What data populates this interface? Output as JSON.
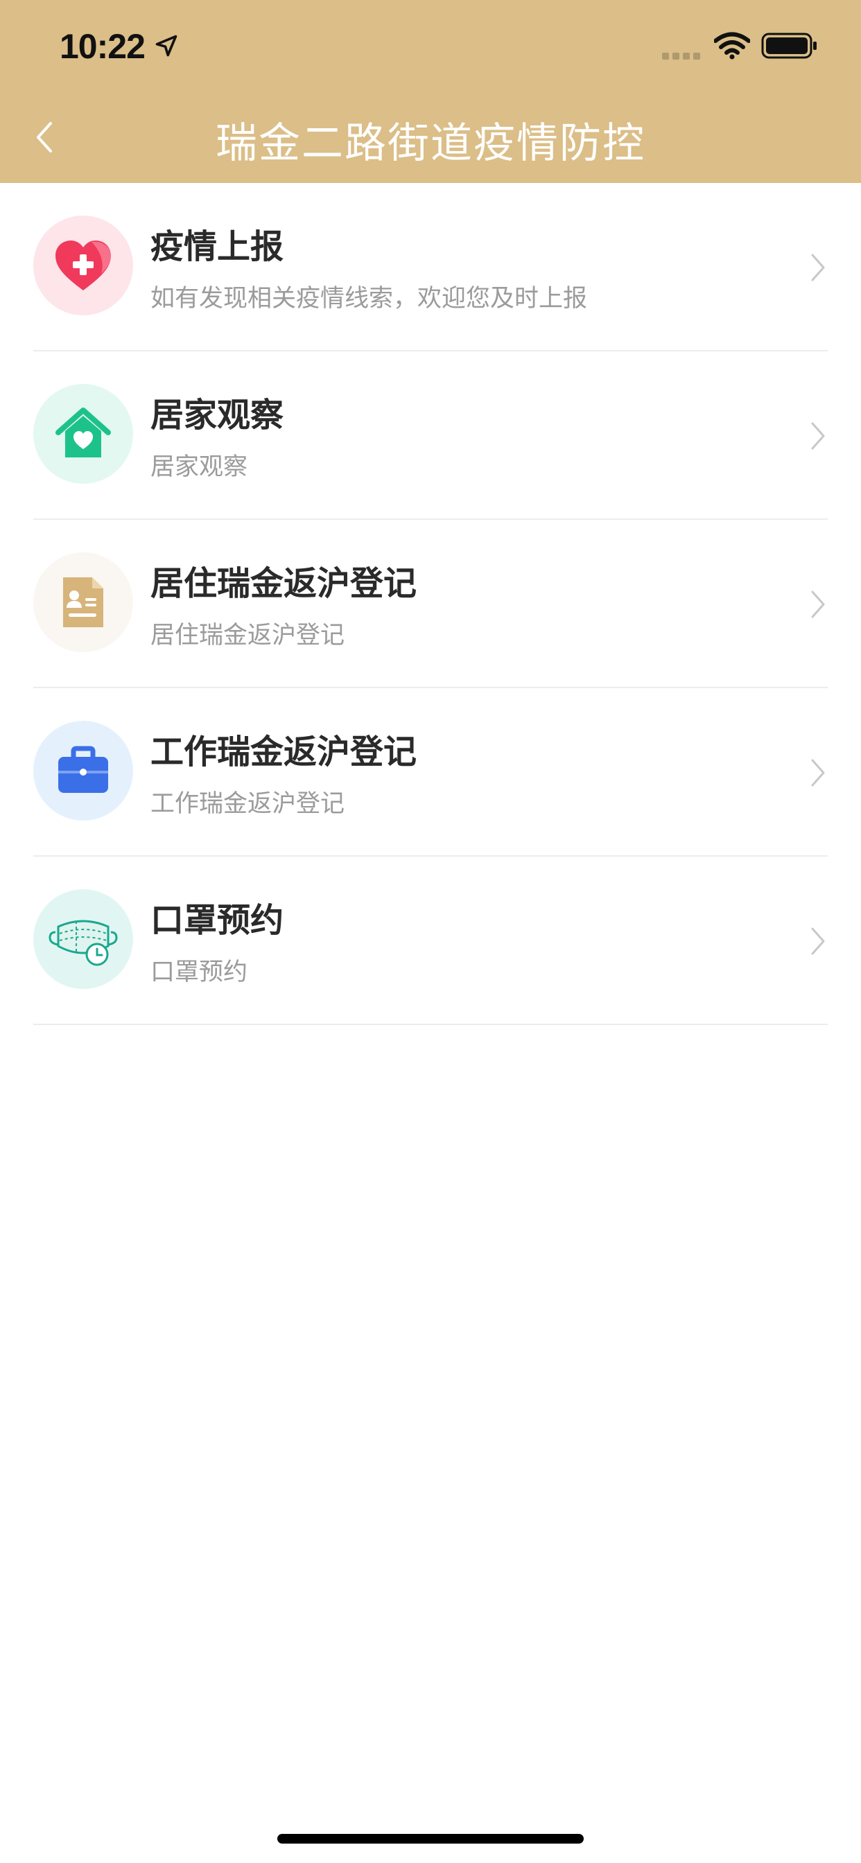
{
  "status_bar": {
    "time": "10:22"
  },
  "nav": {
    "title": "瑞金二路街道疫情防控"
  },
  "colors": {
    "header_bg": "#dbbe88",
    "title_text": "#2a2a2a",
    "subtitle_text": "#9b9b9b",
    "divider": "#ececec"
  },
  "items": [
    {
      "title": "疫情上报",
      "subtitle": "如有发现相关疫情线索，欢迎您及时上报",
      "icon": "heart-plus-icon",
      "icon_bg": "#fde5ea"
    },
    {
      "title": "居家观察",
      "subtitle": "居家观察",
      "icon": "home-heart-icon",
      "icon_bg": "#e3f8f0"
    },
    {
      "title": "居住瑞金返沪登记",
      "subtitle": "居住瑞金返沪登记",
      "icon": "id-document-icon",
      "icon_bg": "#faf6f1"
    },
    {
      "title": "工作瑞金返沪登记",
      "subtitle": "工作瑞金返沪登记",
      "icon": "briefcase-icon",
      "icon_bg": "#e4f1fd"
    },
    {
      "title": "口罩预约",
      "subtitle": "口罩预约",
      "icon": "mask-clock-icon",
      "icon_bg": "#e1f6f2"
    }
  ]
}
